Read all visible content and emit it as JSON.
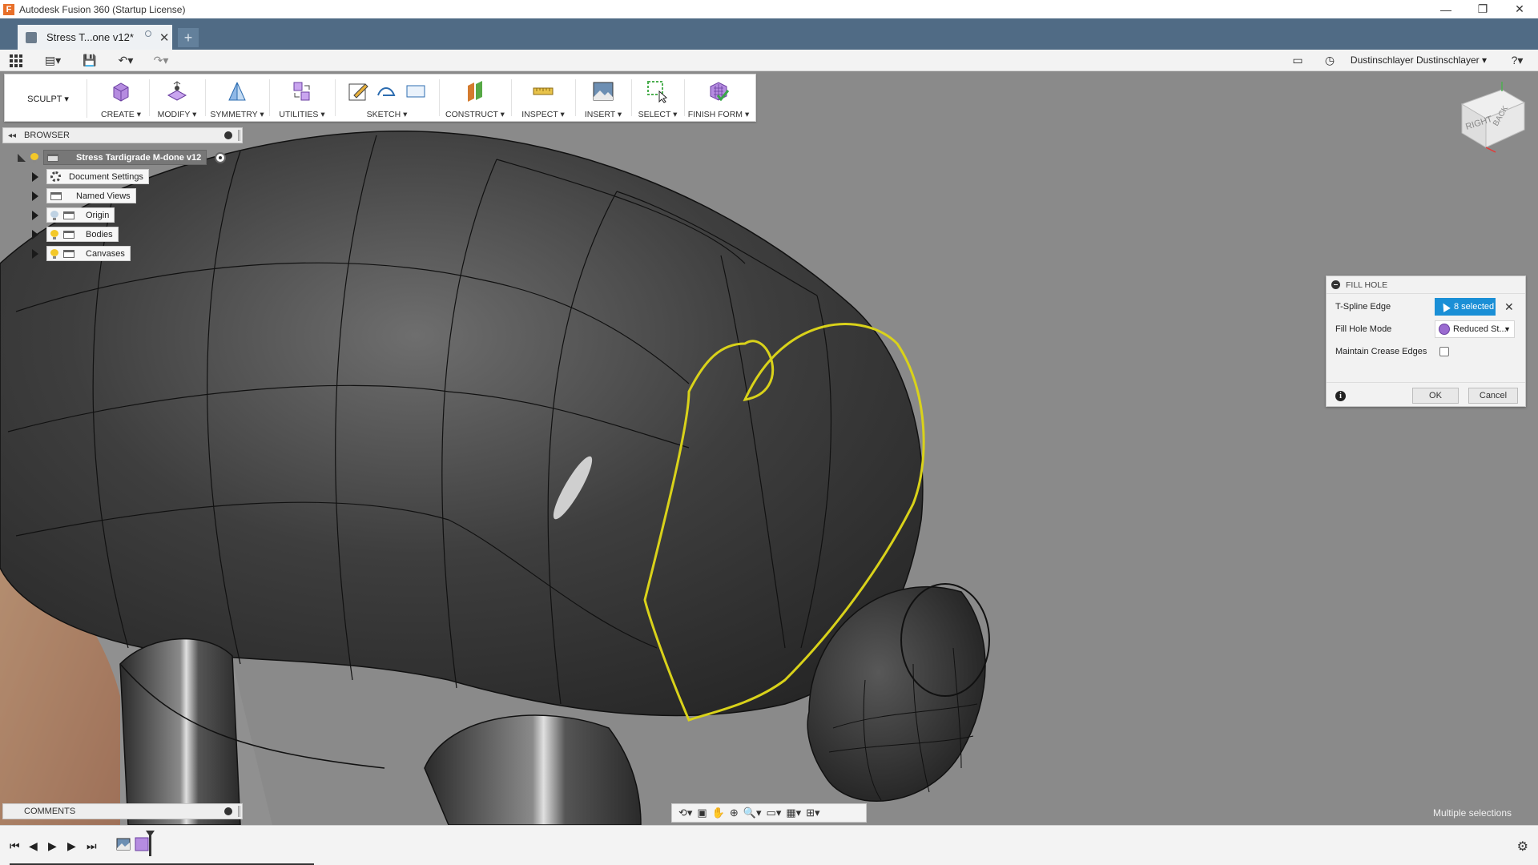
{
  "window": {
    "title": "Autodesk Fusion 360 (Startup License)",
    "controls": [
      "—",
      "❐",
      "✕"
    ]
  },
  "tabs": {
    "active_label": "Stress T...one v12*",
    "new_tab": "+"
  },
  "qat": {
    "user": "Dustinschlayer Dustinschlayer ▾",
    "help": "?▾"
  },
  "ribbon": {
    "workspace": "SCULPT ▾",
    "groups": [
      {
        "label": "CREATE ▾",
        "icon": "create-box-icon"
      },
      {
        "label": "MODIFY ▾",
        "icon": "modify-icon"
      },
      {
        "label": "SYMMETRY ▾",
        "icon": "symmetry-icon"
      },
      {
        "label": "UTILITIES ▾",
        "icon": "utilities-icon"
      },
      {
        "label": "SKETCH ▾",
        "icon": "sketch-icon"
      },
      {
        "label": "CONSTRUCT ▾",
        "icon": "construct-plane-icon"
      },
      {
        "label": "INSPECT ▾",
        "icon": "measure-icon"
      },
      {
        "label": "INSERT ▾",
        "icon": "insert-image-icon"
      },
      {
        "label": "SELECT ▾",
        "icon": "select-icon"
      },
      {
        "label": "FINISH FORM ▾",
        "icon": "finish-form-icon"
      }
    ]
  },
  "browser": {
    "title": "BROWSER",
    "root": "Stress Tardigrade M-done v12",
    "items": [
      {
        "label": "Document Settings"
      },
      {
        "label": "Named Views"
      },
      {
        "label": "Origin"
      },
      {
        "label": "Bodies"
      },
      {
        "label": "Canvases"
      }
    ]
  },
  "viewcube": {
    "face_right": "RIGHT",
    "face_back": "BACK"
  },
  "dialog": {
    "title": "FILL HOLE",
    "rows": {
      "edge_label": "T-Spline Edge",
      "edge_value": "8 selected",
      "mode_label": "Fill Hole Mode",
      "mode_value": "Reduced St...",
      "crease_label": "Maintain Crease Edges",
      "crease_checked": false
    },
    "ok": "OK",
    "cancel": "Cancel"
  },
  "comments": {
    "title": "COMMENTS"
  },
  "status": {
    "text": "Multiple selections"
  },
  "colors": {
    "tabbar": "#506b85",
    "select_blue": "#1a8fd6",
    "selection_yellow": "#d9d21a",
    "viewport_bg": "#8a8a8a"
  }
}
